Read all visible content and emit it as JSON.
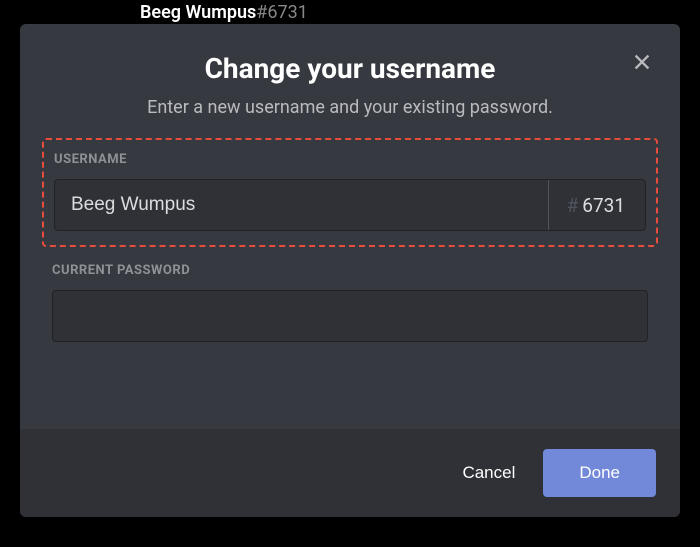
{
  "background": {
    "username_hint": "Beeg Wumpus",
    "tag_hint": "#6731"
  },
  "modal": {
    "title": "Change your username",
    "subtitle": "Enter a new username and your existing password.",
    "username_label": "USERNAME",
    "username_value": "Beeg Wumpus",
    "hash": "#",
    "discriminator": "6731",
    "password_label": "CURRENT PASSWORD",
    "password_value": "",
    "cancel_label": "Cancel",
    "done_label": "Done"
  }
}
